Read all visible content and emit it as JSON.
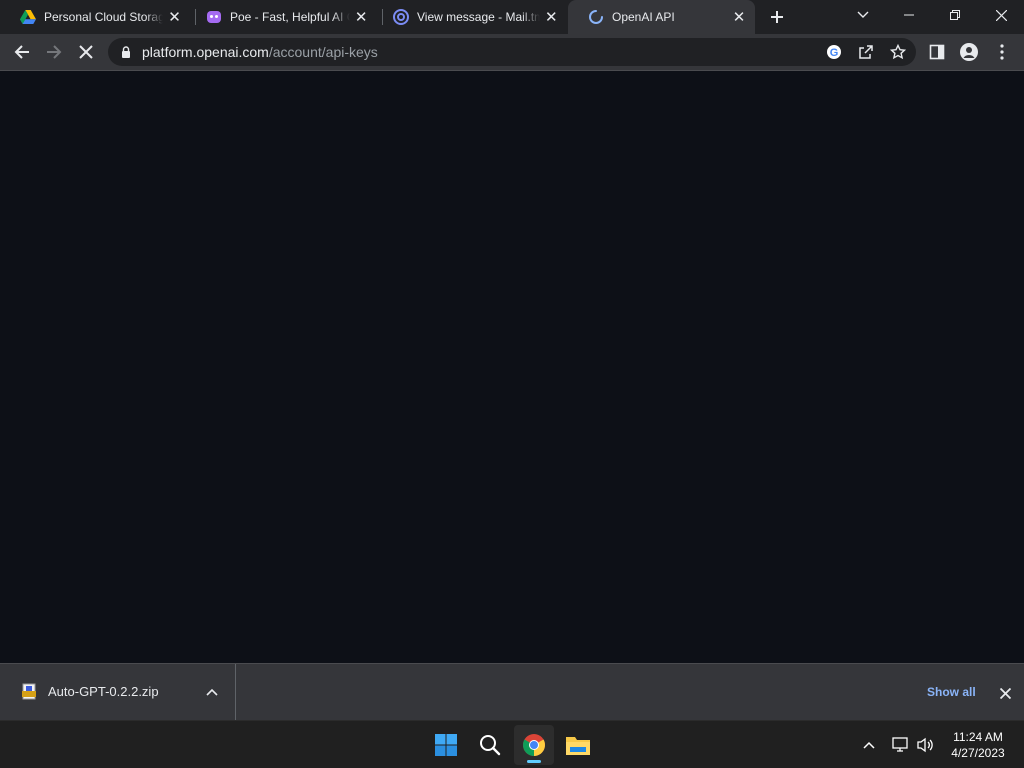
{
  "browser": {
    "tabs": [
      {
        "title": "Personal Cloud Storage",
        "icon": "google-drive-icon",
        "active": false
      },
      {
        "title": "Poe - Fast, Helpful AI Chat",
        "icon": "poe-icon",
        "active": false
      },
      {
        "title": "View message - Mail.tm",
        "icon": "mail-at-icon",
        "active": false
      },
      {
        "title": "OpenAI API",
        "icon": "loading-spinner-icon",
        "active": true
      }
    ],
    "address": {
      "host": "platform.openai.com",
      "path": "/account/api-keys"
    }
  },
  "download_bar": {
    "file_name": "Auto-GPT-0.2.2.zip",
    "show_all_label": "Show all"
  },
  "taskbar": {
    "time": "11:24 AM",
    "date": "4/27/2023"
  },
  "colors": {
    "page_background": "#0d1017",
    "tab_strip": "#202124",
    "toolbar": "#35363a",
    "link_blue": "#8ab4f8"
  }
}
